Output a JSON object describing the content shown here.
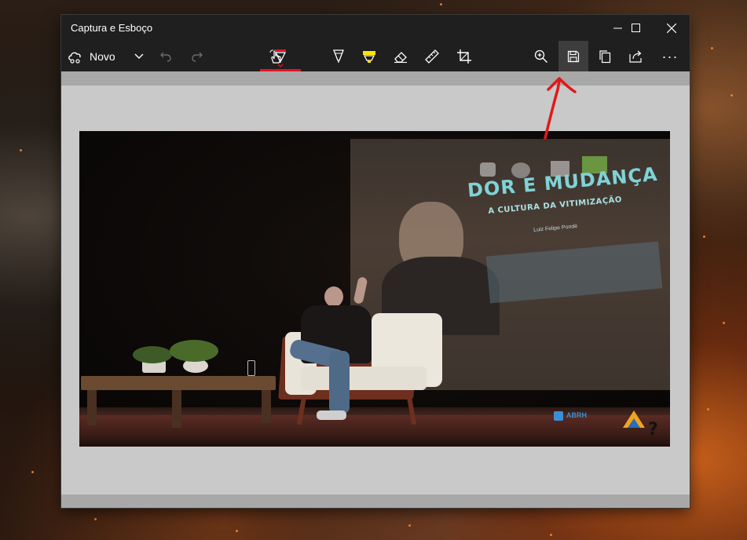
{
  "window": {
    "title": "Captura e Esboço"
  },
  "toolbar": {
    "new_label": "Novo",
    "active_tool": "ballpoint-pen",
    "hovered_button": "save",
    "more_label": "···"
  },
  "captured_image": {
    "slide_title": "DOR E MUDANÇA",
    "slide_subtitle": "A CULTURA DA VITIMIZAÇÃO",
    "slide_author": "Luiz Felipe Pondé",
    "watermark": "ABRH"
  },
  "annotation": {
    "arrow_color": "#e01919",
    "points_to": "save-button"
  },
  "colors": {
    "titlebar_bg": "#1f1f1f",
    "canvas_bg": "#c9c9c9",
    "active_underline": "#e81123",
    "highlighter_yellow": "#ffe500",
    "pen_red": "#e81123"
  }
}
